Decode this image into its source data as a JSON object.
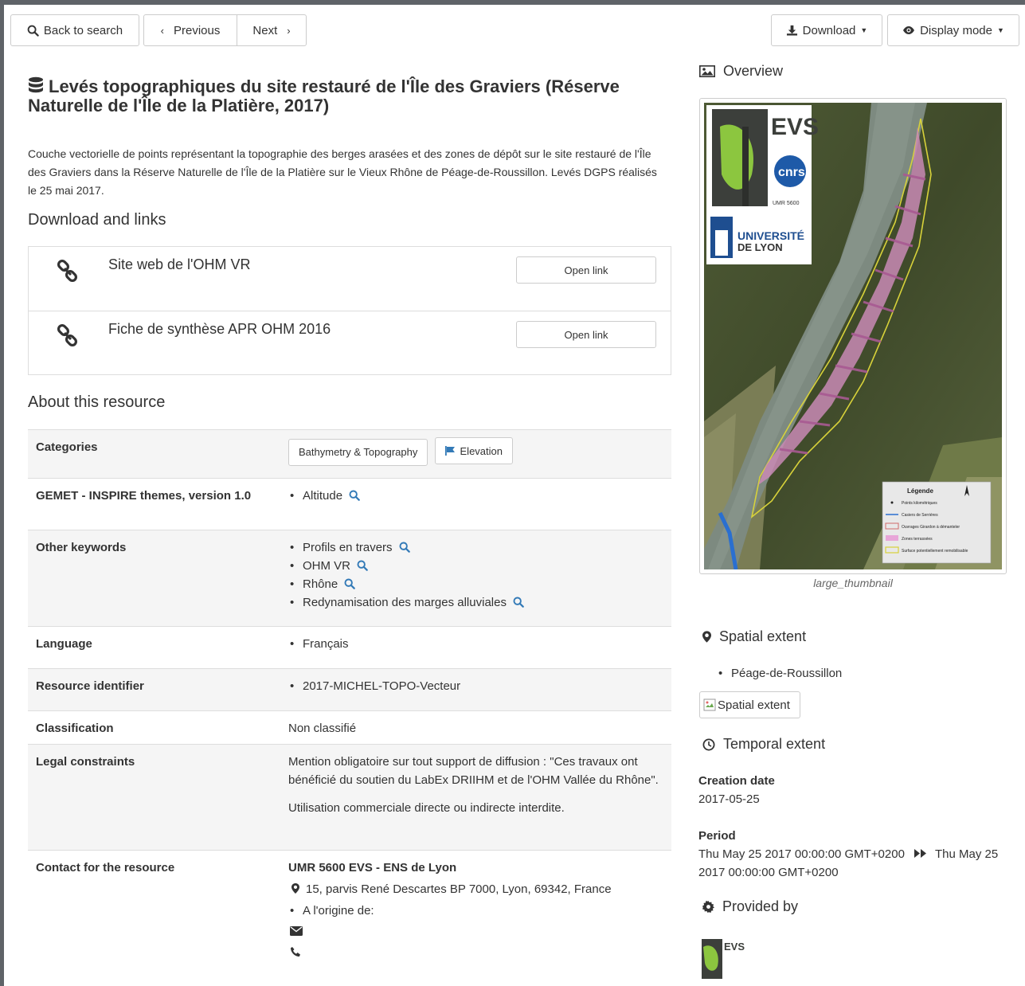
{
  "toolbar": {
    "back_label": "Back to search",
    "previous_label": "Previous",
    "next_label": "Next",
    "download_label": "Download",
    "display_mode_label": "Display mode"
  },
  "record": {
    "title": "Levés topographiques du site restauré de l'Île des Graviers (Réserve Naturelle de l'Île de la Platière, 2017)",
    "description": "Couche vectorielle de points représentant la topographie des berges arasées et des zones de dépôt sur le site restauré de l'Île des Graviers dans la Réserve Naturelle de l'Île de la Platière sur le Vieux Rhône de Péage-de-Roussillon. Levés DGPS réalisés le 25 mai 2017."
  },
  "links_section": {
    "heading": "Download and links",
    "items": [
      {
        "label": "Site web de l'OHM VR",
        "button": "Open link"
      },
      {
        "label": "Fiche de synthèse APR OHM 2016",
        "button": "Open link"
      }
    ]
  },
  "about": {
    "heading": "About this resource",
    "categories_label": "Categories",
    "categories": [
      "Bathymetry & Topography",
      "Elevation"
    ],
    "gemet_label": "GEMET - INSPIRE themes, version 1.0",
    "gemet_values": [
      "Altitude"
    ],
    "keywords_label": "Other keywords",
    "keywords": [
      "Profils en travers",
      "OHM VR",
      "Rhône",
      "Redynamisation des marges alluviales"
    ],
    "language_label": "Language",
    "language": "Français",
    "identifier_label": "Resource identifier",
    "identifier": "2017-MICHEL-TOPO-Vecteur",
    "classification_label": "Classification",
    "classification": "Non classifié",
    "legal_label": "Legal constraints",
    "legal_1": "Mention obligatoire sur tout support de diffusion : \"Ces travaux ont bénéficié du soutien du LabEx DRIIHM et de l'OHM Vallée du Rhône\".",
    "legal_2": "Utilisation commerciale directe ou indirecte interdite.",
    "contact_label": "Contact for the resource",
    "contact_org": "UMR 5600 EVS - ENS de Lyon",
    "contact_address": "15, parvis René Descartes BP 7000, Lyon, 69342, France",
    "contact_role": "A l'origine de:"
  },
  "sidebar": {
    "overview_heading": "Overview",
    "thumb_caption": "large_thumbnail",
    "thumb_logo_text": "EVS",
    "thumb_logo_sub": "UMR 5600",
    "thumb_cnrs": "cnrs",
    "thumb_univ_1": "UNIVERSITÉ",
    "thumb_univ_2": "DE LYON",
    "legend_title": "Légende",
    "legend_items": [
      "Points kilométriques",
      "Casiers de Serriéres",
      "Ouvrages Girardon à démanteler",
      "Zones terrassées",
      "Surface potentiellement remobilisable"
    ],
    "spatial_heading": "Spatial extent",
    "spatial_places": [
      "Péage-de-Roussillon"
    ],
    "spatial_img_alt": "Spatial extent",
    "temporal_heading": "Temporal extent",
    "creation_label": "Creation date",
    "creation_value": "2017-05-25",
    "period_label": "Period",
    "period_start": "Thu May 25 2017 00:00:00 GMT+0200",
    "period_end": "Thu May 25 2017 00:00:00 GMT+0200",
    "provided_heading": "Provided by",
    "provider_logo_text": "EVS"
  },
  "colors": {
    "page_bg": "#ffffff",
    "accent_blue": "#337ab7",
    "border": "#cccccc"
  }
}
